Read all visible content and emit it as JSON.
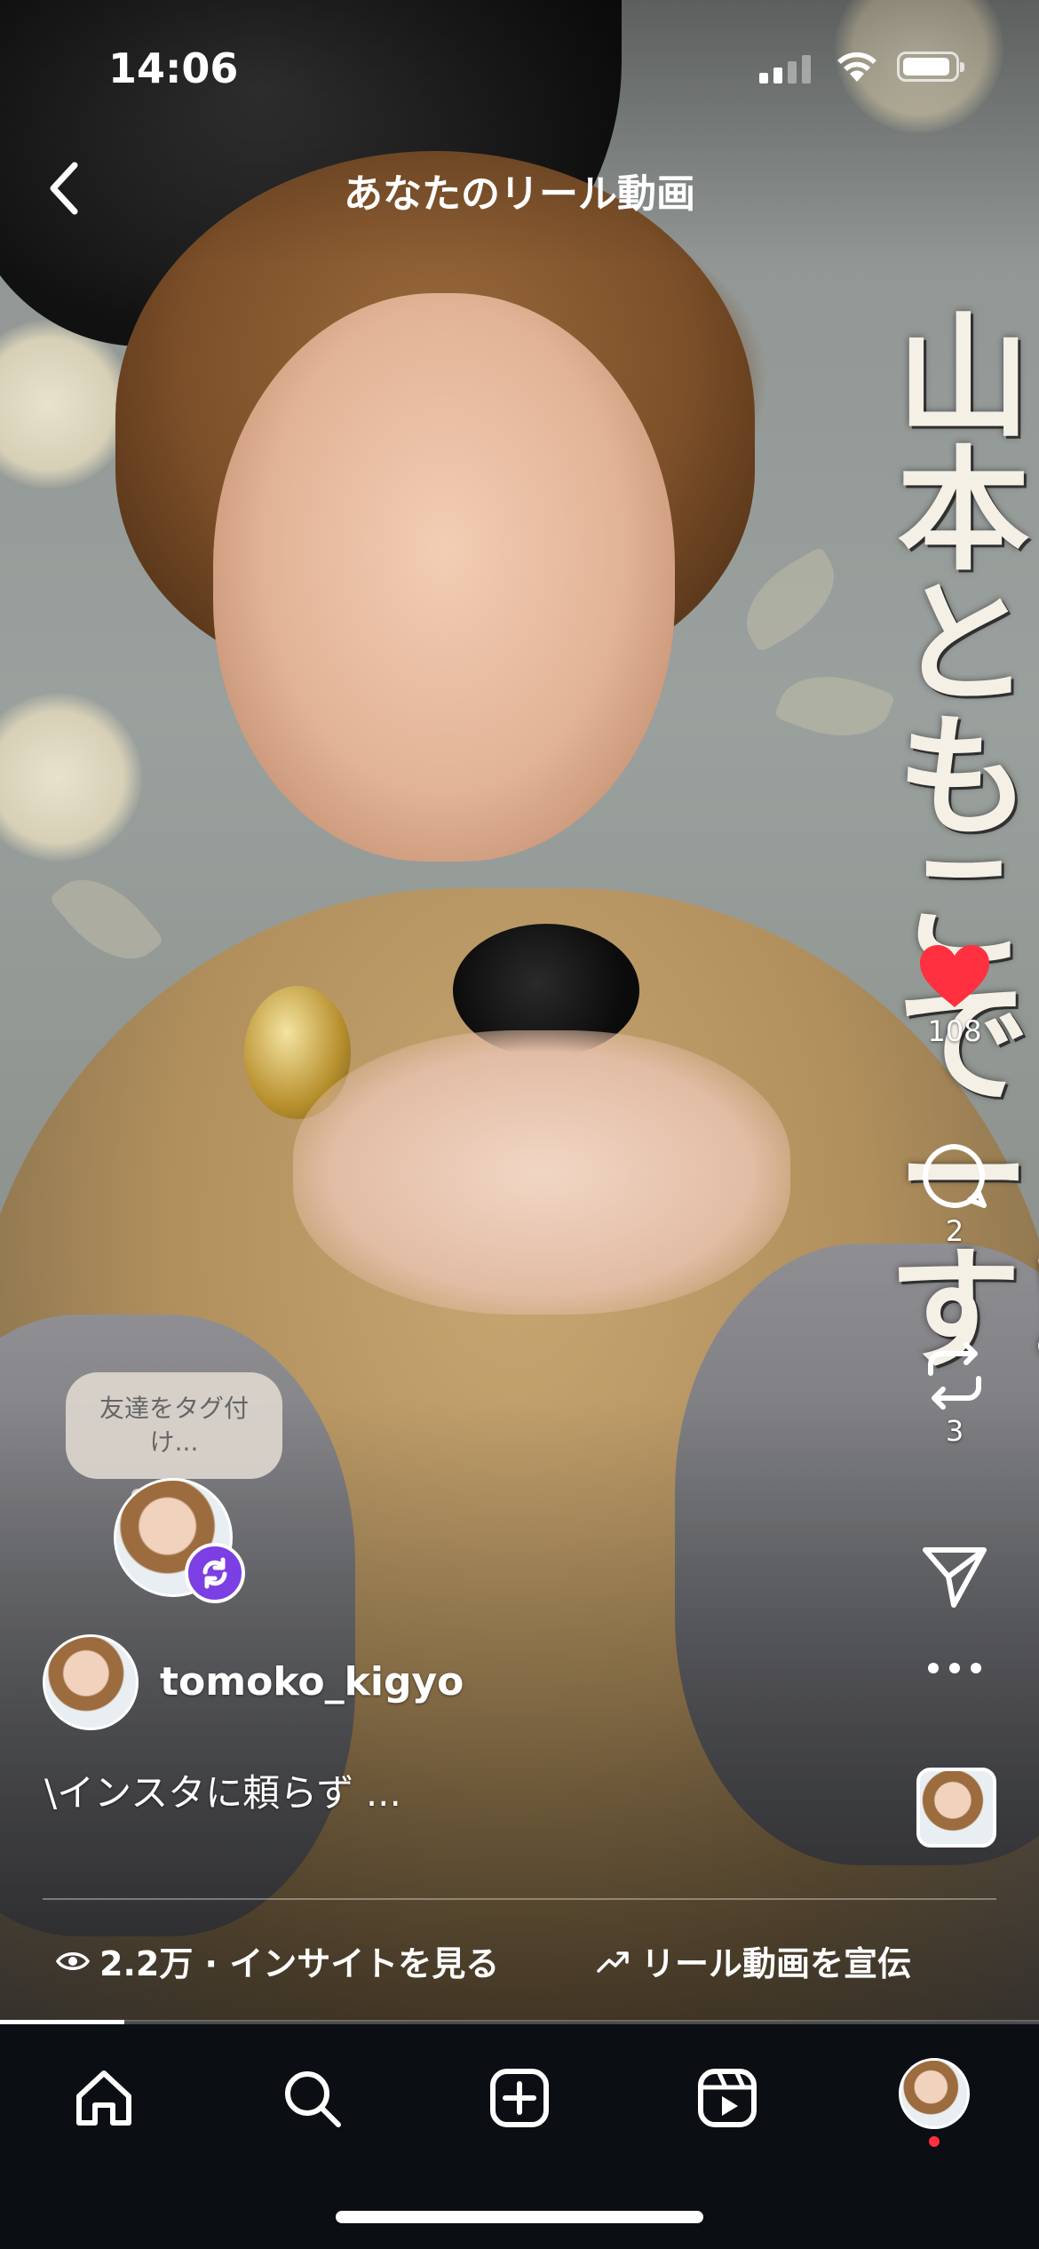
{
  "status_bar": {
    "time": "14:06"
  },
  "header": {
    "title": "あなたのリール動画"
  },
  "video_overlay_text": "山本ともこでーす!!",
  "actions": {
    "like_count": "108",
    "comment_count": "2",
    "remix_count": "3"
  },
  "tag_prompt": "友達をタグ付け...",
  "post": {
    "username": "tomoko_kigyo",
    "caption": "\\インスタに頼らず ..."
  },
  "footer": {
    "insights": "2.2万 · インサイトを見る",
    "promote": "リール動画を宣伝"
  },
  "progress": 0.12,
  "colors": {
    "like": "#ff3040",
    "remix_badge": "#7b3fe4",
    "tabbar_bg": "#0b0e13"
  },
  "icons": [
    "back-chevron-icon",
    "heart-icon",
    "comment-icon",
    "remix-icon",
    "share-icon",
    "more-icon",
    "eye-icon",
    "trend-icon",
    "home-icon",
    "search-icon",
    "create-icon",
    "reels-icon"
  ]
}
